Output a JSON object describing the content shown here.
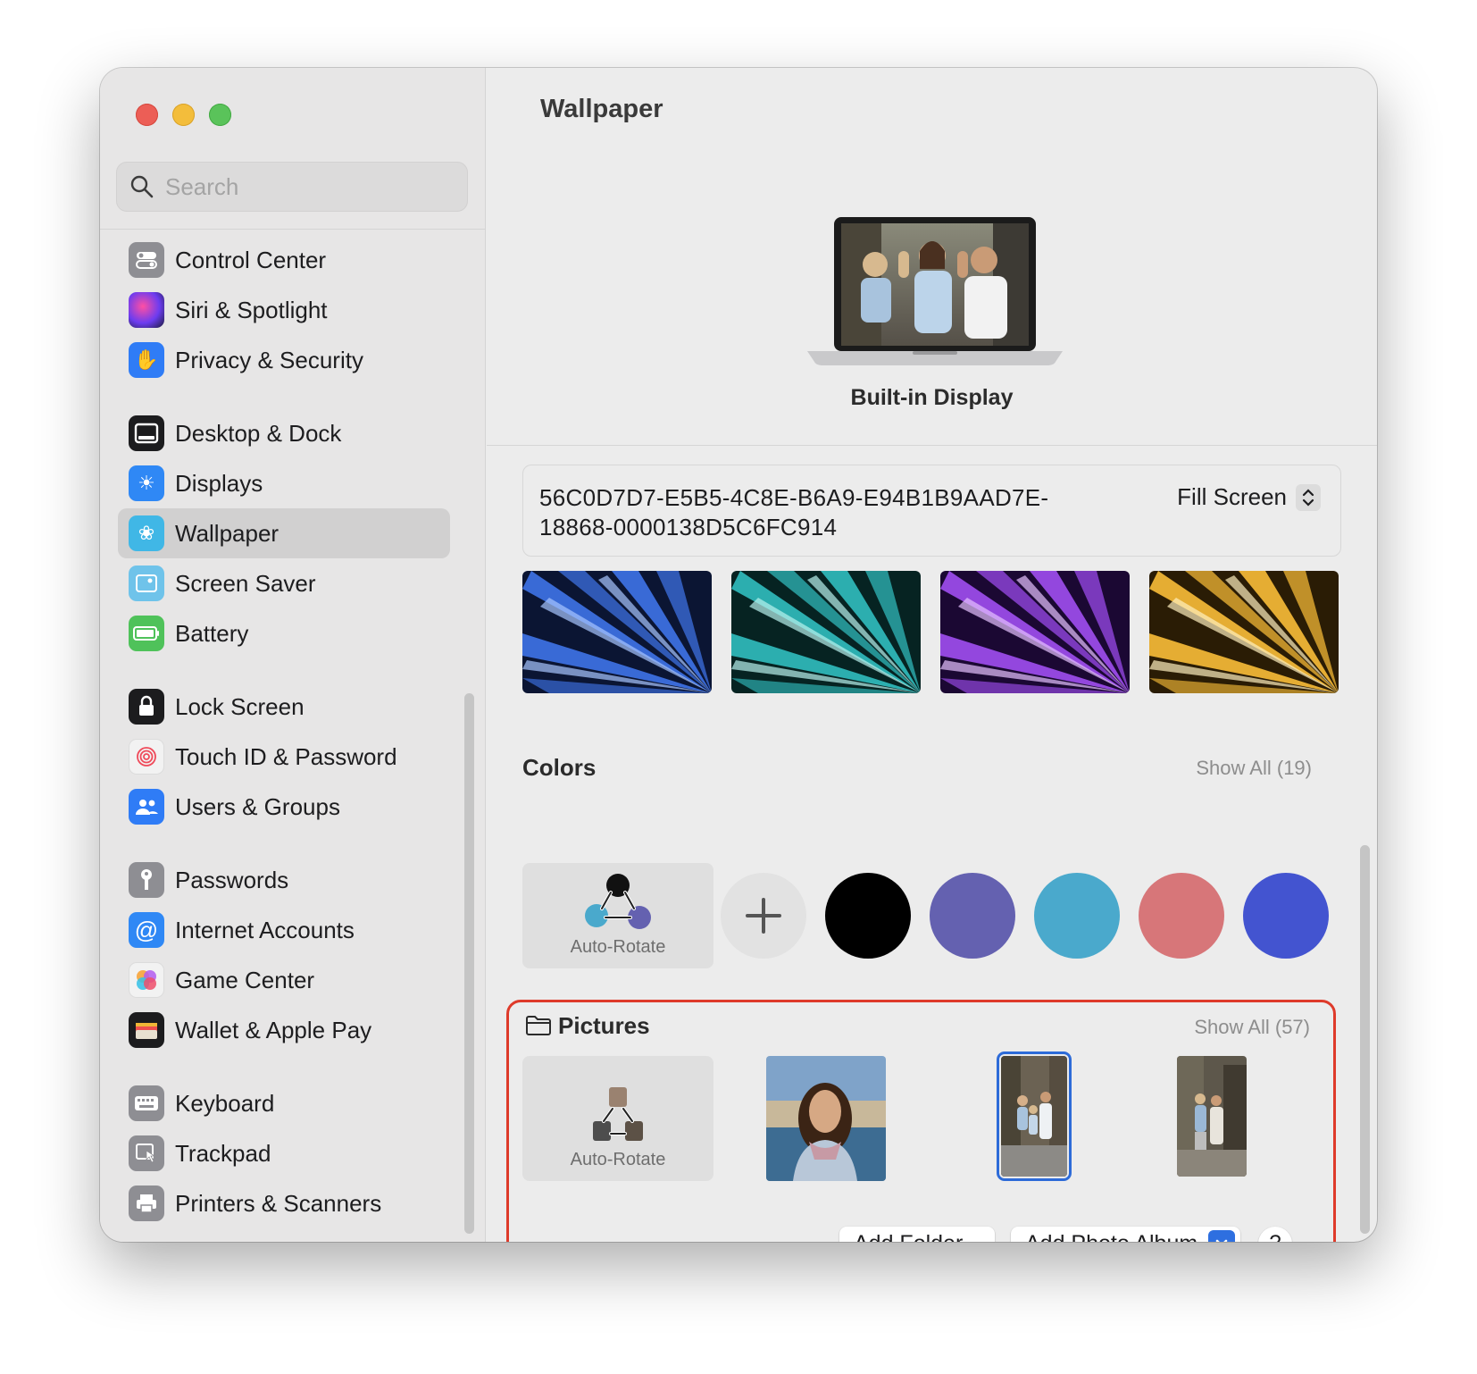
{
  "sidebar": {
    "search_placeholder": "Search",
    "items": [
      {
        "label": "Control Center",
        "color": "#8e8e93"
      },
      {
        "label": "Siri & Spotlight",
        "color": "#5b3fc4"
      },
      {
        "label": "Privacy & Security",
        "color": "#2f7cf6"
      },
      {
        "label": "Desktop & Dock",
        "color": "#1c1c1e"
      },
      {
        "label": "Displays",
        "color": "#2f88f5"
      },
      {
        "label": "Wallpaper",
        "color": "#40b7e6"
      },
      {
        "label": "Screen Saver",
        "color": "#6fc3ea"
      },
      {
        "label": "Battery",
        "color": "#4fc25a"
      },
      {
        "label": "Lock Screen",
        "color": "#1c1c1e"
      },
      {
        "label": "Touch ID & Password",
        "color": "#f2f2f2"
      },
      {
        "label": "Users & Groups",
        "color": "#2f7cf6"
      },
      {
        "label": "Passwords",
        "color": "#8e8e93"
      },
      {
        "label": "Internet Accounts",
        "color": "#2f88f5"
      },
      {
        "label": "Game Center",
        "color": "#f2f2f2"
      },
      {
        "label": "Wallet & Apple Pay",
        "color": "#1c1c1e"
      },
      {
        "label": "Keyboard",
        "color": "#8e8e93"
      },
      {
        "label": "Trackpad",
        "color": "#8e8e93"
      },
      {
        "label": "Printers & Scanners",
        "color": "#8e8e93"
      }
    ],
    "selected": "Wallpaper"
  },
  "main": {
    "title": "Wallpaper",
    "display_name": "Built-in Display",
    "file_name": "56C0D7D7-E5B5-4C8E-B6A9-E94B1B9AAD7E-18868-0000138D5C6FC914",
    "fit_mode": "Fill Screen",
    "colors": {
      "title": "Colors",
      "show_all": "Show All (19)",
      "auto_rotate": "Auto-Rotate",
      "swatches": [
        "#000000",
        "#6461b0",
        "#4aa9cc",
        "#d77679",
        "#4354d0"
      ]
    },
    "pictures": {
      "title": "Pictures",
      "show_all": "Show All (57)",
      "auto_rotate": "Auto-Rotate",
      "add_folder": "Add Folder...",
      "add_album": "Add Photo Album",
      "help": "?"
    },
    "thumb_colors": [
      "#3d6fe0",
      "#2fb7b8",
      "#9a4be8",
      "#f0b636"
    ]
  }
}
